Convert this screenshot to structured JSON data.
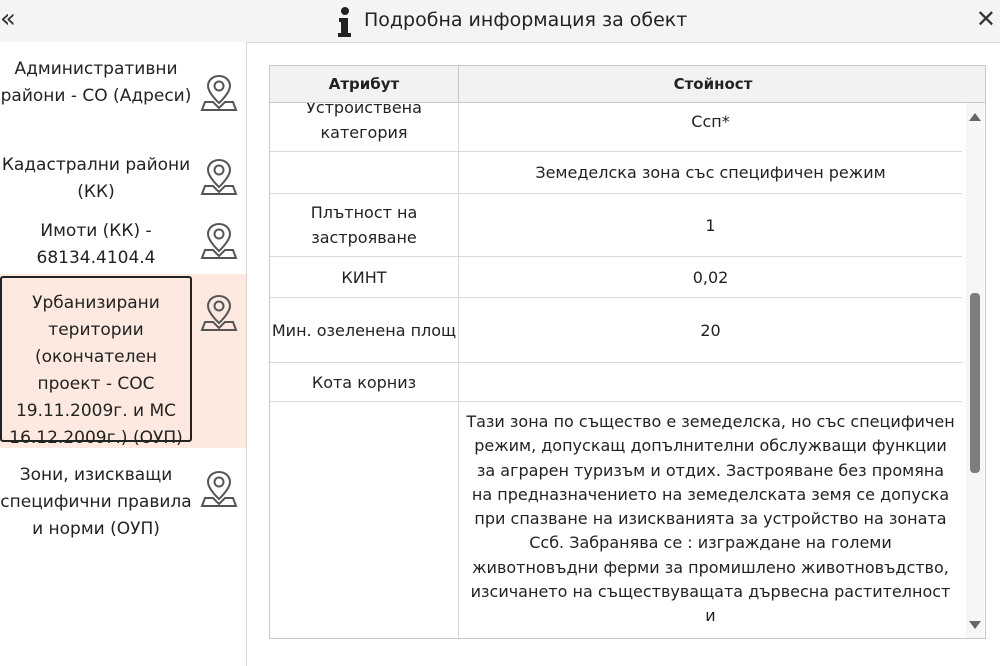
{
  "header": {
    "title": "Подробна информация за обект",
    "collapse_icon": "«",
    "close_icon": "✕"
  },
  "sidebar": {
    "items": [
      {
        "label": "Административни райони - СО (Адреси)",
        "selected": false
      },
      {
        "label": "Кадастрални райони (КК)",
        "selected": false
      },
      {
        "label": "Имоти (КК) - 68134.4104.4",
        "selected": false
      },
      {
        "label": "Урбанизирани територии (окончателен проект - СОС 19.11.2009г. и МС 16.12.2009г.) (ОУП)",
        "selected": true
      },
      {
        "label": "Зони, изискващи специфични правила и норми (ОУП)",
        "selected": false
      }
    ]
  },
  "table": {
    "headers": {
      "attribute": "Атрибут",
      "value": "Стойност"
    },
    "rows": [
      {
        "attribute": "Устройствена категория",
        "value": "Ссп*"
      },
      {
        "attribute": "",
        "value": "Земеделска зона със специфичен режим"
      },
      {
        "attribute": "Плътност на застрояване",
        "value": "1"
      },
      {
        "attribute": "КИНТ",
        "value": "0,02"
      },
      {
        "attribute": "Мин. озеленена площ",
        "value": "20"
      },
      {
        "attribute": "Кота корниз",
        "value": ""
      },
      {
        "attribute": "",
        "value": "Тази зона по същество е земеделска, но със специфичен режим, допускащ допълнителни обслужващи функции за аграрен туризъм и отдих. Застрояване без промяна на предназначението на земеделската земя се допуска при спазване на изискванията за устройство на зоната Ссб. Забранява се : изграждане на големи животновъдни ферми за промишлено животновъдство, изсичането на съществуващата дървесна растителност и"
      }
    ]
  }
}
